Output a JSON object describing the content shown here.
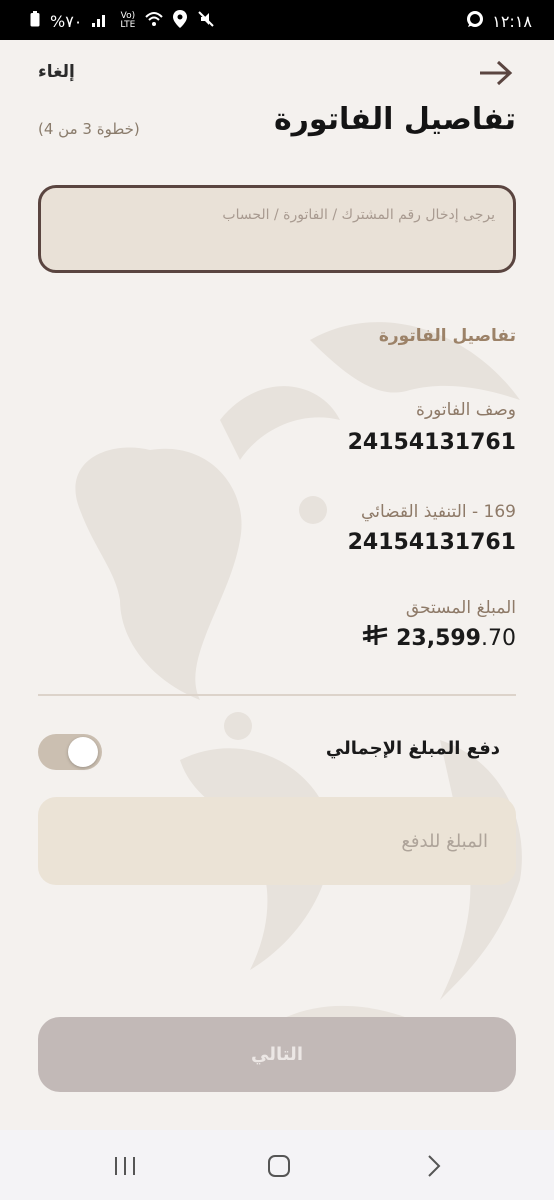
{
  "status_bar": {
    "time": "١٢:١٨",
    "battery": "%٧٠",
    "network_top": "Vo)",
    "network_bottom": "LTE"
  },
  "header": {
    "cancel_label": "إلغاء",
    "title": "تفاصيل الفاتورة",
    "step_text": "(خطوة 3 من 4)",
    "back_icon": "arrow-right-icon"
  },
  "search": {
    "placeholder": "يرجى إدخال رقم المشترك / الفاتورة / الحساب",
    "value": ""
  },
  "details": {
    "section_title": "تفاصيل الفاتورة",
    "description_label": "وصف الفاتورة",
    "description_value": "24154131761",
    "service_label": "169 - التنفيذ القضائي",
    "service_value": "24154131761",
    "due_label": "المبلغ المستحق",
    "due_amount_int": "23,599",
    "due_amount_dec": ".70",
    "currency_icon": "riyal-icon"
  },
  "payment": {
    "toggle_label": "دفع المبلغ الإجمالي",
    "toggle_on": true,
    "amount_placeholder": "المبلغ للدفع"
  },
  "next_button": {
    "label": "التالي"
  },
  "colors": {
    "background": "#f4f1ee",
    "accent_brown": "#5a4540",
    "label_brown": "#8e7a68",
    "button_disabled": "#c2b9b7"
  }
}
